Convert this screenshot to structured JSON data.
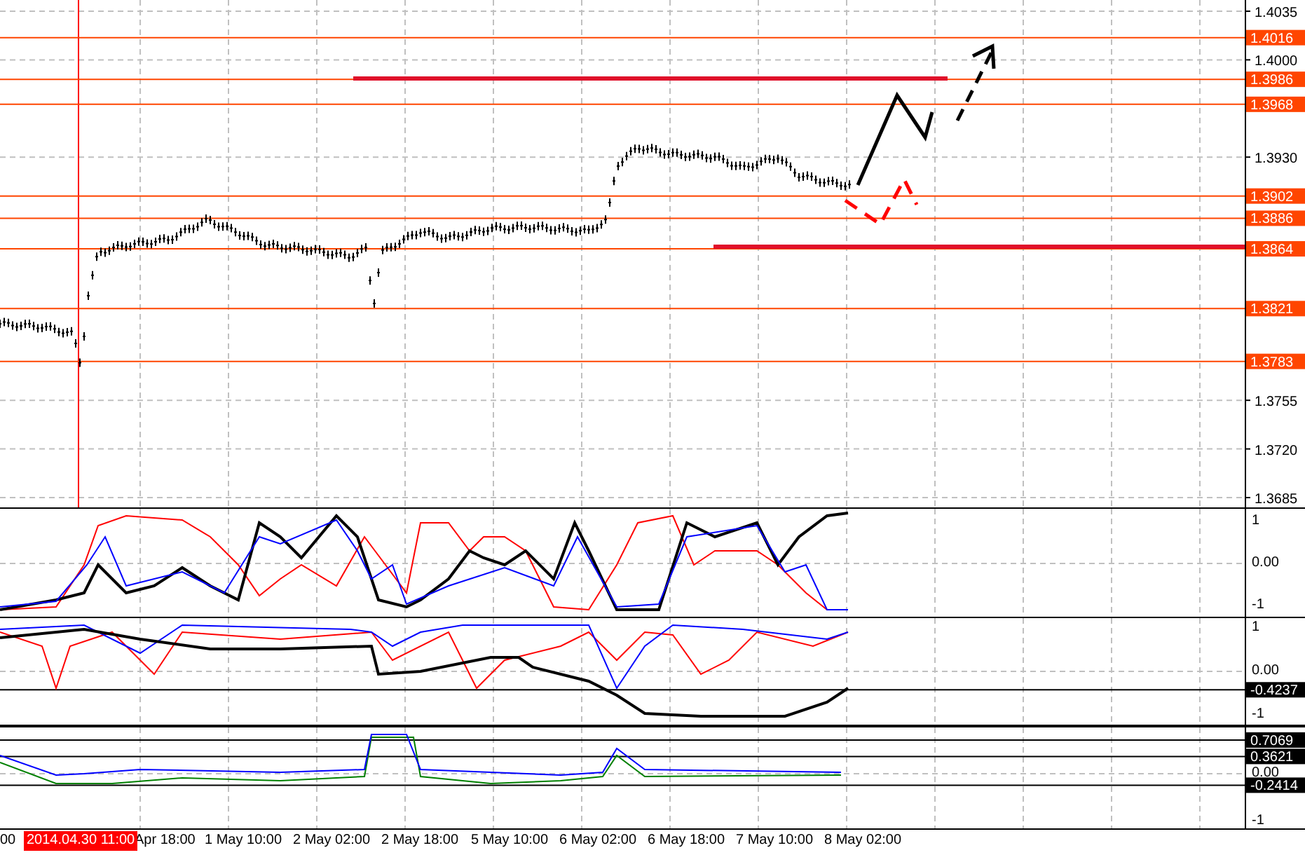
{
  "price_chart": {
    "axis_labels": [
      "1.4035",
      "1.4000",
      "1.3930",
      "1.3755",
      "1.3720",
      "1.3685"
    ],
    "price_levels": [
      "1.4016",
      "1.3986",
      "1.3968",
      "1.3902",
      "1.3886",
      "1.3864",
      "1.3821",
      "1.3783"
    ]
  },
  "indicator_panels": [
    {
      "axis_labels": [
        "1",
        "0.00",
        "-1"
      ]
    },
    {
      "axis_labels": [
        "1",
        "0.00",
        "-1"
      ],
      "value_tags": [
        "-0.4237"
      ]
    },
    {
      "axis_labels": [
        "0.00",
        "-1"
      ],
      "value_tags": [
        "0.7069",
        "0.3621",
        "-0.2414"
      ]
    }
  ],
  "time_axis": {
    "labels": [
      "00",
      "Apr 18:00",
      "1 May 10:00",
      "2 May 02:00",
      "2 May 18:00",
      "5 May 10:00",
      "6 May 02:00",
      "6 May 18:00",
      "7 May 10:00",
      "8 May 02:00"
    ],
    "cursor_label": "2014.04.30 11:00"
  }
}
